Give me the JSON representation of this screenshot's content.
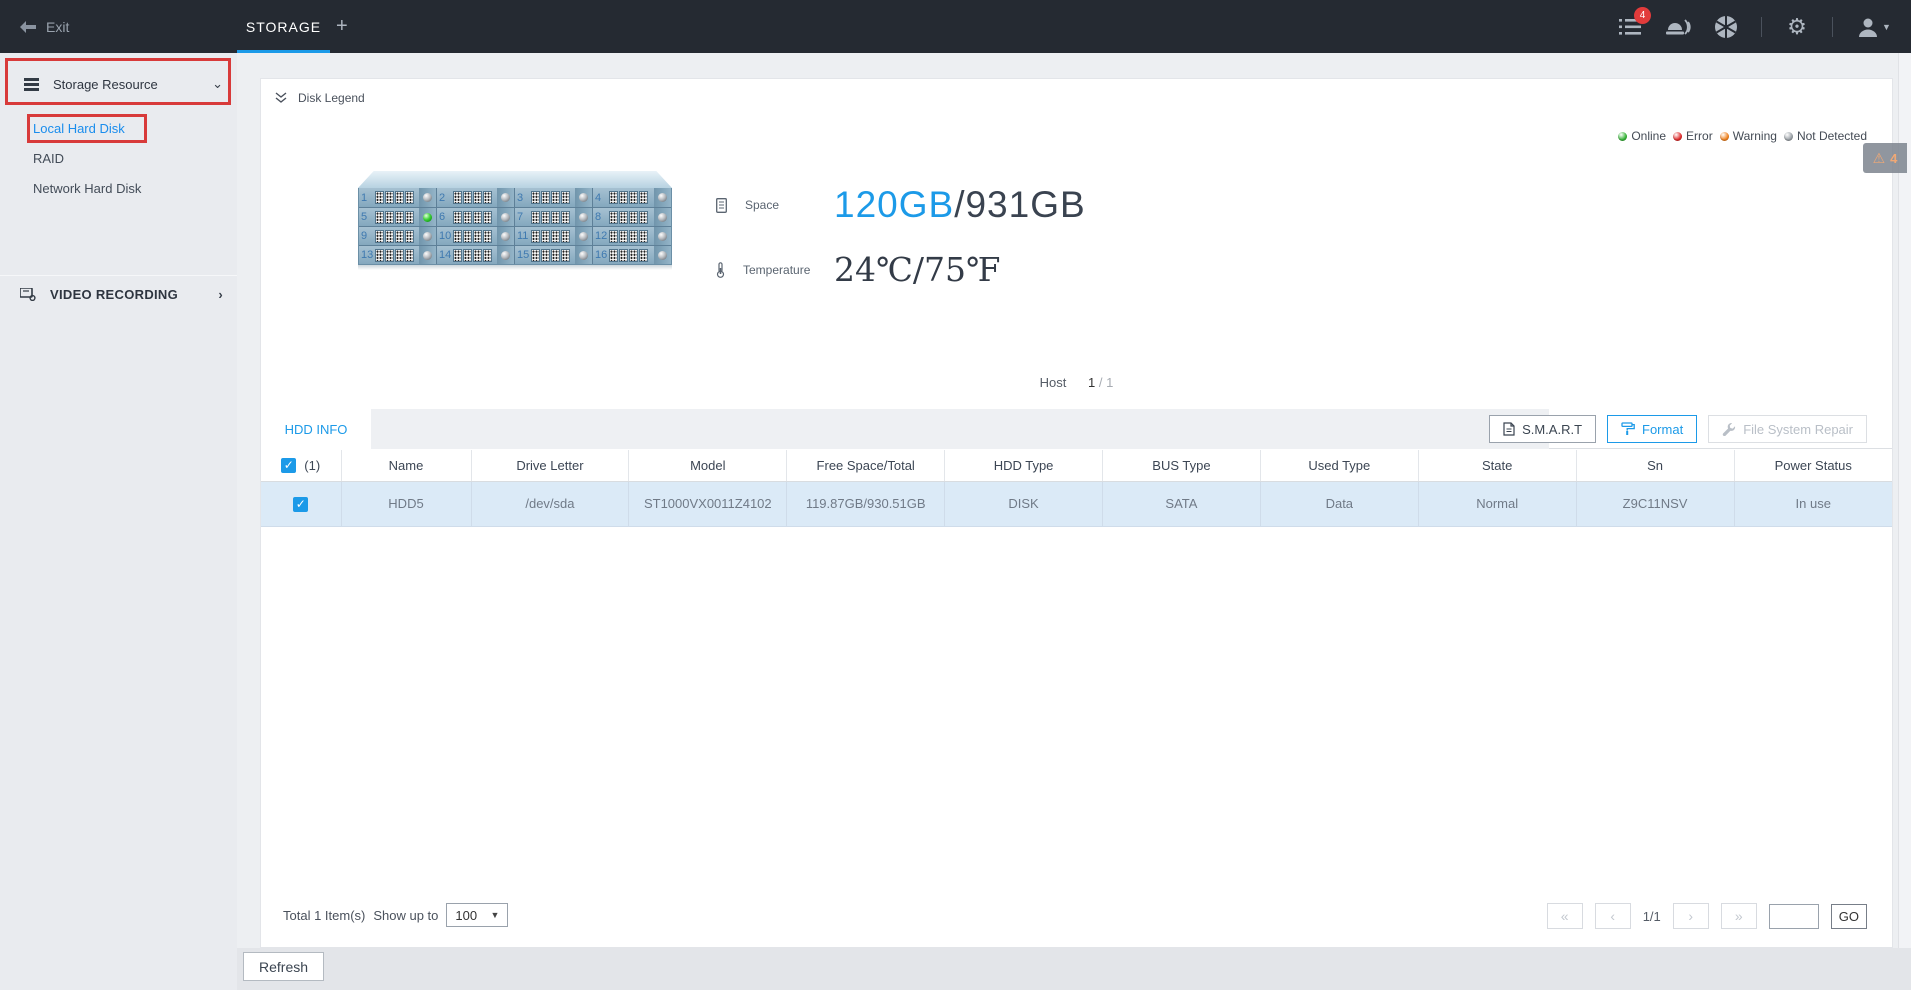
{
  "topbar": {
    "exit_label": "Exit",
    "tab_label": "STORAGE",
    "add_tab_label": "+",
    "alarm_badge": "4"
  },
  "sidebar": {
    "storage_resource": {
      "label": "Storage Resource"
    },
    "items": [
      {
        "label": "Local Hard Disk",
        "active": true
      },
      {
        "label": "RAID",
        "active": false
      },
      {
        "label": "Network Hard Disk",
        "active": false
      }
    ],
    "video_recording": {
      "label": "VIDEO RECORDING"
    }
  },
  "panel": {
    "header_label": "Disk Legend",
    "legend": [
      {
        "label": "Online",
        "color": "#36b437"
      },
      {
        "label": "Error",
        "color": "#e02b2b"
      },
      {
        "label": "Warning",
        "color": "#f0821e"
      },
      {
        "label": "Not Detected",
        "color": "#9aa0a6"
      }
    ],
    "device": {
      "rows": 4,
      "cols": 4,
      "online_slots": [
        5
      ]
    },
    "space": {
      "label": "Space",
      "used": "120GB",
      "separator": "/",
      "total": "931GB"
    },
    "temperature": {
      "label": "Temperature",
      "value": "24℃/75℉"
    },
    "host": {
      "label": "Host",
      "current": "1",
      "total": "/ 1"
    },
    "hdd_tab_label": "HDD INFO",
    "buttons": {
      "smart": "S.M.A.R.T",
      "format": "Format",
      "repair": "File System Repair"
    },
    "table": {
      "select_header": "(1)",
      "headers": [
        "Name",
        "Drive Letter",
        "Model",
        "Free Space/Total",
        "HDD Type",
        "BUS Type",
        "Used Type",
        "State",
        "Sn",
        "Power Status"
      ],
      "rows": [
        {
          "checked": true,
          "cells": [
            "HDD5",
            "/dev/sda",
            "ST1000VX0011Z4102",
            "119.87GB/930.51GB",
            "DISK",
            "SATA",
            "Data",
            "Normal",
            "Z9C11NSV",
            "In use"
          ]
        }
      ]
    },
    "pagination": {
      "total_label": "Total 1 Item(s)",
      "show_label": "Show up to",
      "page_size": "100",
      "first": "«",
      "prev": "‹",
      "page": "1/1",
      "next": "›",
      "last": "»",
      "go_label": "GO",
      "jump_value": ""
    }
  },
  "alarm_flyout": {
    "count": "4",
    "icon": "⚠"
  },
  "statusbar": {
    "refresh_label": "Refresh"
  },
  "colors": {
    "accent": "#1c9ae8",
    "annotation": "#d83a3a",
    "badge": "#e23b3b"
  }
}
